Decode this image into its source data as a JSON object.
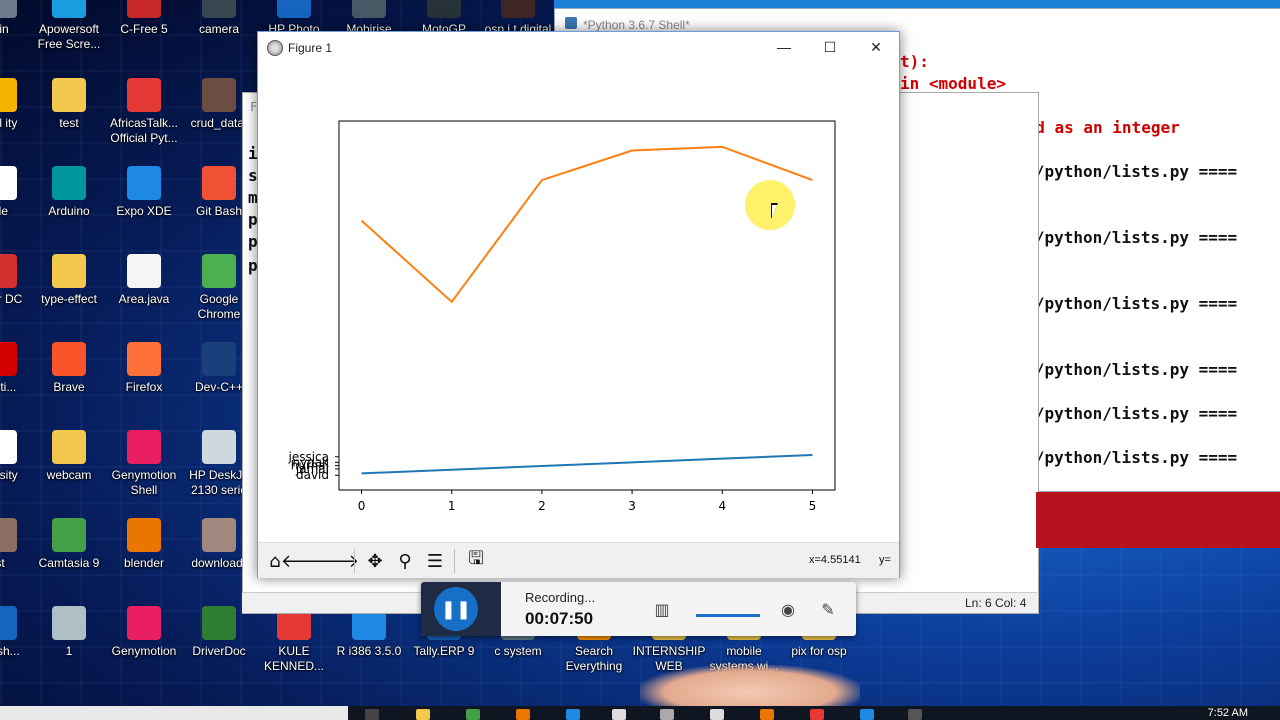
{
  "desktop": {
    "icons": [
      {
        "label": "Bin",
        "color": "#6c7a8a"
      },
      {
        "label": "Apowersoft Free Scre...",
        "color": "#1a9de0"
      },
      {
        "label": "C-Free 5",
        "color": "#c62828"
      },
      {
        "label": "camera",
        "color": "#37474f"
      },
      {
        "label": "HP Photo",
        "color": "#1565c0"
      },
      {
        "label": "Mobirise",
        "color": "#455a64"
      },
      {
        "label": "MotoGP",
        "color": "#263238"
      },
      {
        "label": "osp i.t digital",
        "color": "#3e2723"
      },
      {
        "label": "otal ity",
        "color": "#f5b400"
      },
      {
        "label": "test",
        "color": "#f2c94c"
      },
      {
        "label": "AfricasTalk... Official Pyt...",
        "color": "#e53935"
      },
      {
        "label": "crud_datat",
        "color": "#6d4c41"
      },
      {
        "label": "ole",
        "color": "#ffffff"
      },
      {
        "label": "Arduino",
        "color": "#00979c"
      },
      {
        "label": "Expo XDE",
        "color": "#1e88e5"
      },
      {
        "label": "Git Bash",
        "color": "#f05033"
      },
      {
        "label": "bat r DC",
        "color": "#d32f2f"
      },
      {
        "label": "type-effect",
        "color": "#f2c94c"
      },
      {
        "label": "Area.java",
        "color": "#f5f5f5"
      },
      {
        "label": "Google Chrome",
        "color": "#4caf50"
      },
      {
        "label": "be ti...",
        "color": "#d50000"
      },
      {
        "label": "Brave",
        "color": "#fb542b"
      },
      {
        "label": "Firefox",
        "color": "#ff7139"
      },
      {
        "label": "Dev-C++",
        "color": "#1a3f7a"
      },
      {
        "label": "m rsity",
        "color": "#ffffff"
      },
      {
        "label": "webcam",
        "color": "#f2c94c"
      },
      {
        "label": "Genymotion Shell",
        "color": "#e91e63"
      },
      {
        "label": "HP DeskJe 2130 serie",
        "color": "#cfd8dc"
      },
      {
        "label": "st",
        "color": "#8d6e63"
      },
      {
        "label": "Camtasia 9",
        "color": "#43a047"
      },
      {
        "label": "blender",
        "color": "#ea7600"
      },
      {
        "label": "download-",
        "color": "#a1887f"
      },
      {
        "label": "be sh...",
        "color": "#1565c0"
      },
      {
        "label": "1",
        "color": "#b0bec5"
      },
      {
        "label": "Genymotion",
        "color": "#e91e63"
      },
      {
        "label": "DriverDoc",
        "color": "#2e7d32"
      },
      {
        "label": "KULE KENNED...",
        "color": "#e53935"
      },
      {
        "label": "R i386 3.5.0",
        "color": "#1e88e5"
      },
      {
        "label": "Tally.ERP 9",
        "color": "#1565c0"
      },
      {
        "label": "c system",
        "color": "#607d8b"
      },
      {
        "label": "Search Everything",
        "color": "#ff9800"
      },
      {
        "label": "INTERNSHIP WEB",
        "color": "#f2c94c"
      },
      {
        "label": "mobile systems wi...",
        "color": "#f2c94c"
      },
      {
        "label": "pix for osp",
        "color": "#f2c94c"
      }
    ]
  },
  "shell": {
    "title": "*Python 3.6.7 Shell*",
    "lines": [
      {
        "text": "t):",
        "red": true
      },
      {
        "text": "in <module>",
        "red": true
      },
      {
        "text": "be interpreted as an integer",
        "red": true
      },
      {
        "text": "rs/osp/Desktop/python/lists.py ====",
        "red": false
      },
      {
        "text": "rs/osp/Desktop/python/lists.py ====",
        "red": false
      },
      {
        "text": "rs/osp/Desktop/python/lists.py ====",
        "red": false
      },
      {
        "text": "rs/osp/Desktop/python/lists.py ====",
        "red": false
      },
      {
        "text": "rs/osp/Desktop/python/lists.py ====",
        "red": false
      },
      {
        "text": "rs/osp/Desktop/python/lists.py ====",
        "red": false
      }
    ]
  },
  "editor": {
    "status_position": "Ln: 6   Col: 4",
    "partial_lines": [
      "i",
      "s",
      "m",
      "p",
      "p",
      "p"
    ],
    "partial_label": "Fi"
  },
  "figure": {
    "title": "Figure 1",
    "minimize_icon": "—",
    "maximize_icon": "☐",
    "close_icon": "✕",
    "coords_x": "x=4.55141",
    "coords_y": "y=",
    "toolbar_icons": [
      "home-icon",
      "back-icon",
      "forward-icon",
      "pan-icon",
      "zoom-icon",
      "configure-icon",
      "save-icon"
    ]
  },
  "chart_data": {
    "type": "line",
    "x": [
      0,
      1,
      2,
      3,
      4,
      5
    ],
    "xlim": [
      -0.25,
      5.25
    ],
    "x_ticks": [
      "0",
      "1",
      "2",
      "3",
      "4",
      "5"
    ],
    "series": [
      {
        "color": "#ff7f0e",
        "values": [
          0.73,
          0.51,
          0.84,
          0.92,
          0.93,
          0.84
        ]
      },
      {
        "color": "#1f77b4",
        "values": [
          0.045,
          0.055,
          0.065,
          0.075,
          0.085,
          0.095
        ]
      }
    ],
    "ylim": [
      0,
      1.0
    ],
    "y_tick_labels": [
      {
        "text": "jessica",
        "y": 0.09
      },
      {
        "text": "nynak",
        "y": 0.075
      },
      {
        "text": "hurhal",
        "y": 0.066
      },
      {
        "text": "jamal",
        "y": 0.057
      },
      {
        "text": "david",
        "y": 0.04
      }
    ]
  },
  "recorder": {
    "status": "Recording...",
    "time": "00:07:50",
    "pause_icon": "❚❚"
  },
  "taskbar": {
    "clock": "7:52 AM"
  }
}
